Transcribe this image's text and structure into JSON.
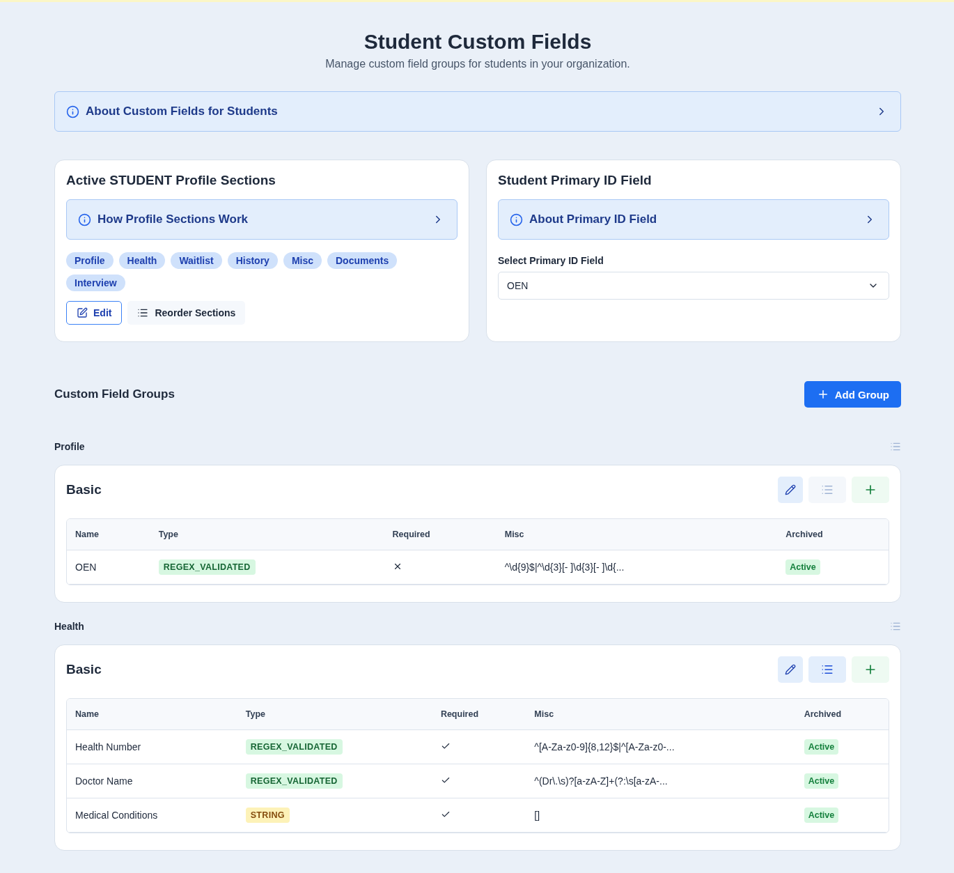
{
  "header": {
    "title": "Student Custom Fields",
    "subtitle": "Manage custom field groups for students in your organization."
  },
  "about_banner": {
    "label": "About Custom Fields for Students"
  },
  "sections_card": {
    "title": "Active STUDENT Profile Sections",
    "info": "How Profile Sections Work",
    "sections": [
      "Profile",
      "Health",
      "Waitlist",
      "History",
      "Misc",
      "Documents",
      "Interview"
    ],
    "edit_button": "Edit",
    "reorder_button": "Reorder Sections"
  },
  "primary_id_card": {
    "title": "Student Primary ID Field",
    "info": "About Primary ID Field",
    "select_label": "Select Primary ID Field",
    "select_value": "OEN"
  },
  "groups_header": {
    "title": "Custom Field Groups",
    "add_button": "Add Group"
  },
  "sections": [
    {
      "name": "Profile",
      "groups": [
        {
          "title": "Basic",
          "reorder_selected": false,
          "columns": [
            "Name",
            "Type",
            "Required",
            "Misc",
            "Archived"
          ],
          "rows": [
            {
              "name": "OEN",
              "type": {
                "label": "REGEX_VALIDATED",
                "kind": "regex"
              },
              "required": false,
              "misc": "^\\d{9}$|^\\d{3}[- ]\\d{3}[- ]\\d{...",
              "archived": "Active"
            }
          ]
        }
      ]
    },
    {
      "name": "Health",
      "groups": [
        {
          "title": "Basic",
          "reorder_selected": true,
          "columns": [
            "Name",
            "Type",
            "Required",
            "Misc",
            "Archived"
          ],
          "rows": [
            {
              "name": "Health Number",
              "type": {
                "label": "REGEX_VALIDATED",
                "kind": "regex"
              },
              "required": true,
              "misc": "^[A-Za-z0-9]{8,12}$|^[A-Za-z0-...",
              "archived": "Active"
            },
            {
              "name": "Doctor Name",
              "type": {
                "label": "REGEX_VALIDATED",
                "kind": "regex"
              },
              "required": true,
              "misc": "^(Dr\\.\\s)?[a-zA-Z]+(?:\\s[a-zA-...",
              "archived": "Active"
            },
            {
              "name": "Medical Conditions",
              "type": {
                "label": "STRING",
                "kind": "string"
              },
              "required": true,
              "misc": "[]",
              "archived": "Active"
            }
          ]
        }
      ]
    }
  ]
}
